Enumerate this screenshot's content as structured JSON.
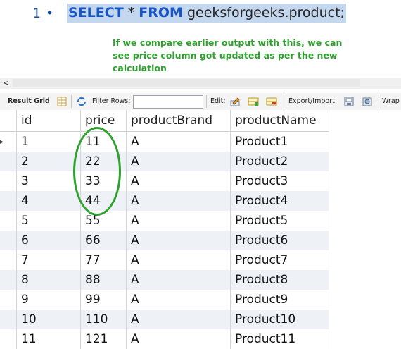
{
  "editor": {
    "line_number": "1",
    "bullet": "•",
    "sql_select": "SELECT",
    "sql_star": "*",
    "sql_from": "FROM",
    "sql_table": "geeksforgeeks.product;",
    "annotation": "If we compare earlier output with this, we can see price column got updated as per the new calculation",
    "annotation_color": "#2fa12f",
    "selection_color": "#c3d7ee",
    "keyword_color": "#1a55c4"
  },
  "scrollbar": {
    "left_arrow": "<"
  },
  "toolbar": {
    "result_grid": "Result Grid",
    "filter_rows": "Filter Rows:",
    "filter_value": "",
    "edit": "Edit:",
    "export_import": "Export/Import:",
    "wrap": "Wrap"
  },
  "grid": {
    "columns": [
      "id",
      "price",
      "productBrand",
      "productName"
    ],
    "current_row_marker": "▸",
    "rows": [
      [
        "1",
        "11",
        "A",
        "Product1"
      ],
      [
        "2",
        "22",
        "A",
        "Product2"
      ],
      [
        "3",
        "33",
        "A",
        "Product3"
      ],
      [
        "4",
        "44",
        "A",
        "Product4"
      ],
      [
        "5",
        "55",
        "A",
        "Product5"
      ],
      [
        "6",
        "66",
        "A",
        "Product6"
      ],
      [
        "7",
        "77",
        "A",
        "Product7"
      ],
      [
        "8",
        "88",
        "A",
        "Product8"
      ],
      [
        "9",
        "99",
        "A",
        "Product9"
      ],
      [
        "10",
        "110",
        "A",
        "Product10"
      ],
      [
        "11",
        "121",
        "A",
        "Product11"
      ]
    ]
  }
}
